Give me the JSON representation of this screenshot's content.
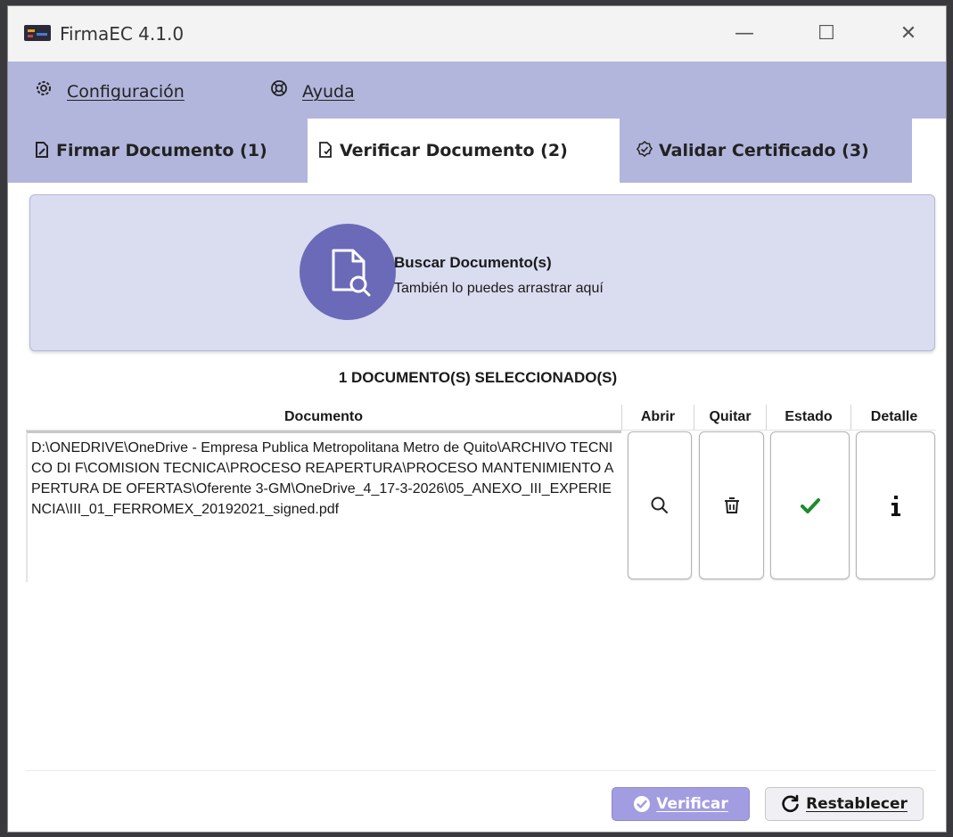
{
  "window": {
    "title": "FirmaEC 4.1.0",
    "controls": {
      "minimize": "—",
      "maximize": "☐",
      "close": "✕"
    }
  },
  "menu": {
    "items": [
      {
        "label": "Configuración",
        "icon": "settings-gear-icon"
      },
      {
        "label": "Ayuda",
        "icon": "help-icon"
      }
    ]
  },
  "tabs": [
    {
      "label": "Firmar Documento (1)",
      "icon": "sign-document-icon",
      "active": false
    },
    {
      "label": "Verificar Documento (2)",
      "icon": "verify-document-icon",
      "active": true
    },
    {
      "label": "Validar Certificado (3)",
      "icon": "validate-certificate-icon",
      "active": false
    }
  ],
  "drop_zone": {
    "title": "Buscar Documento(s)",
    "subtitle": "También lo puedes arrastrar aquí",
    "icon": "document-search-icon"
  },
  "table": {
    "count_label": "1 DOCUMENTO(S) SELECCIONADO(S)",
    "headers": [
      "Documento",
      "Abrir",
      "Quitar",
      "Estado",
      "Detalle"
    ],
    "rows": [
      {
        "documento": "D:\\ONEDRIVE\\OneDrive - Empresa Publica Metropolitana Metro de Quito\\ARCHIVO TECNICO DI F\\COMISION TECNICA\\PROCESO REAPERTURA\\PROCESO MANTENIMIENTO APERTURA DE OFERTAS\\Oferente 3-GM\\OneDrive_4_17-3-2026\\05_ANEXO_III_EXPERIENCIA\\III_01_FERROMEX_20192021_signed.pdf",
        "abrir_icon": "search-icon",
        "quitar_icon": "trash-icon",
        "estado_icon": "valid-check-icon",
        "detalle_icon": "info-icon"
      }
    ]
  },
  "actions": {
    "verificar_label": "Verificar",
    "restablecer_label": "Restablecer"
  },
  "colors": {
    "menu_bg": "#b2b6dc",
    "drop_zone_bg": "#dadcf0",
    "accent": "#6a6ab8",
    "primary_button": "#a29de0",
    "check": "#1e8a2e"
  }
}
